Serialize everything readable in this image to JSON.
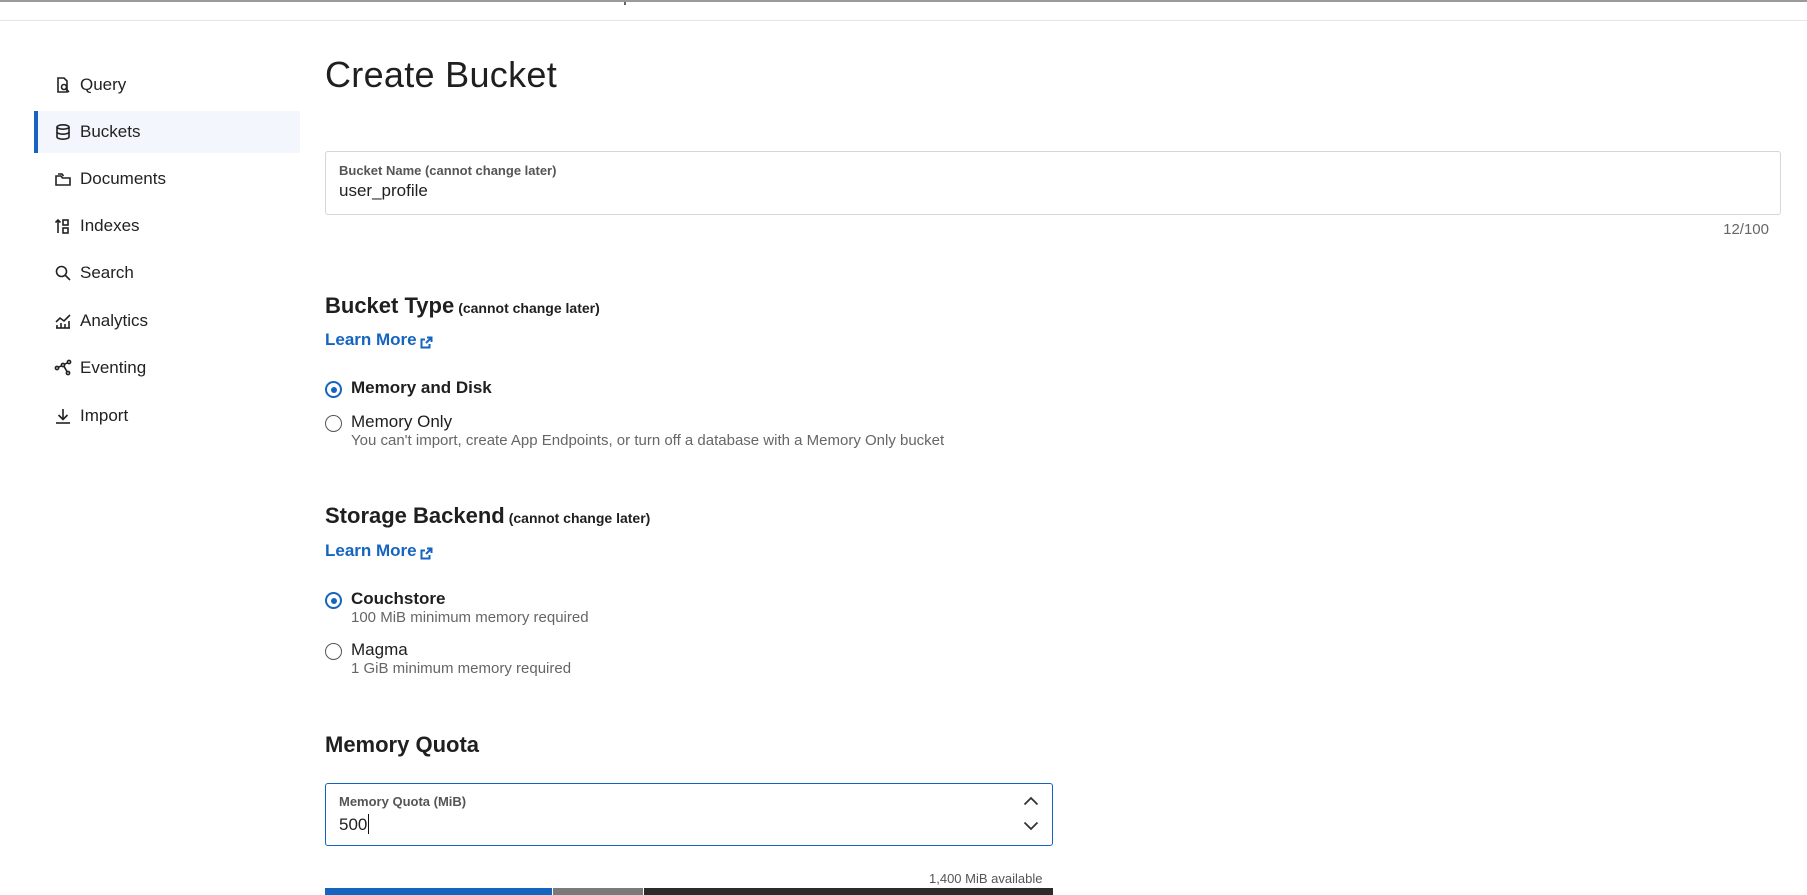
{
  "sidebar": {
    "items": [
      {
        "label": "Query",
        "icon": "query-icon"
      },
      {
        "label": "Buckets",
        "icon": "database-icon",
        "active": true
      },
      {
        "label": "Documents",
        "icon": "documents-icon"
      },
      {
        "label": "Indexes",
        "icon": "indexes-icon"
      },
      {
        "label": "Search",
        "icon": "search-icon"
      },
      {
        "label": "Analytics",
        "icon": "analytics-icon"
      },
      {
        "label": "Eventing",
        "icon": "eventing-icon"
      },
      {
        "label": "Import",
        "icon": "import-icon"
      }
    ]
  },
  "page": {
    "title": "Create Bucket"
  },
  "bucket_name": {
    "label": "Bucket Name (cannot change later)",
    "value": "user_profile",
    "counter": "12/100"
  },
  "bucket_type": {
    "title": "Bucket Type",
    "subtitle": "(cannot change later)",
    "learn_more": "Learn More",
    "options": [
      {
        "label": "Memory and Disk",
        "checked": true
      },
      {
        "label": "Memory Only",
        "help": "You can't import, create App Endpoints, or turn off a database with a Memory Only bucket",
        "checked": false
      }
    ]
  },
  "storage_backend": {
    "title": "Storage Backend",
    "subtitle": "(cannot change later)",
    "learn_more": "Learn More",
    "options": [
      {
        "label": "Couchstore",
        "help": "100 MiB minimum memory required",
        "checked": true
      },
      {
        "label": "Magma",
        "help": "1 GiB minimum memory required",
        "checked": false
      }
    ]
  },
  "memory_quota": {
    "title": "Memory Quota",
    "label": "Memory Quota (MiB)",
    "value": "500",
    "available": "1,400 MiB available"
  },
  "colors": {
    "accent": "#1565c0",
    "active_bg": "#f3f7fd",
    "bar_blue": "#1565c0",
    "bar_grey": "#7a7a7a",
    "bar_dark": "#2b2b2b"
  }
}
